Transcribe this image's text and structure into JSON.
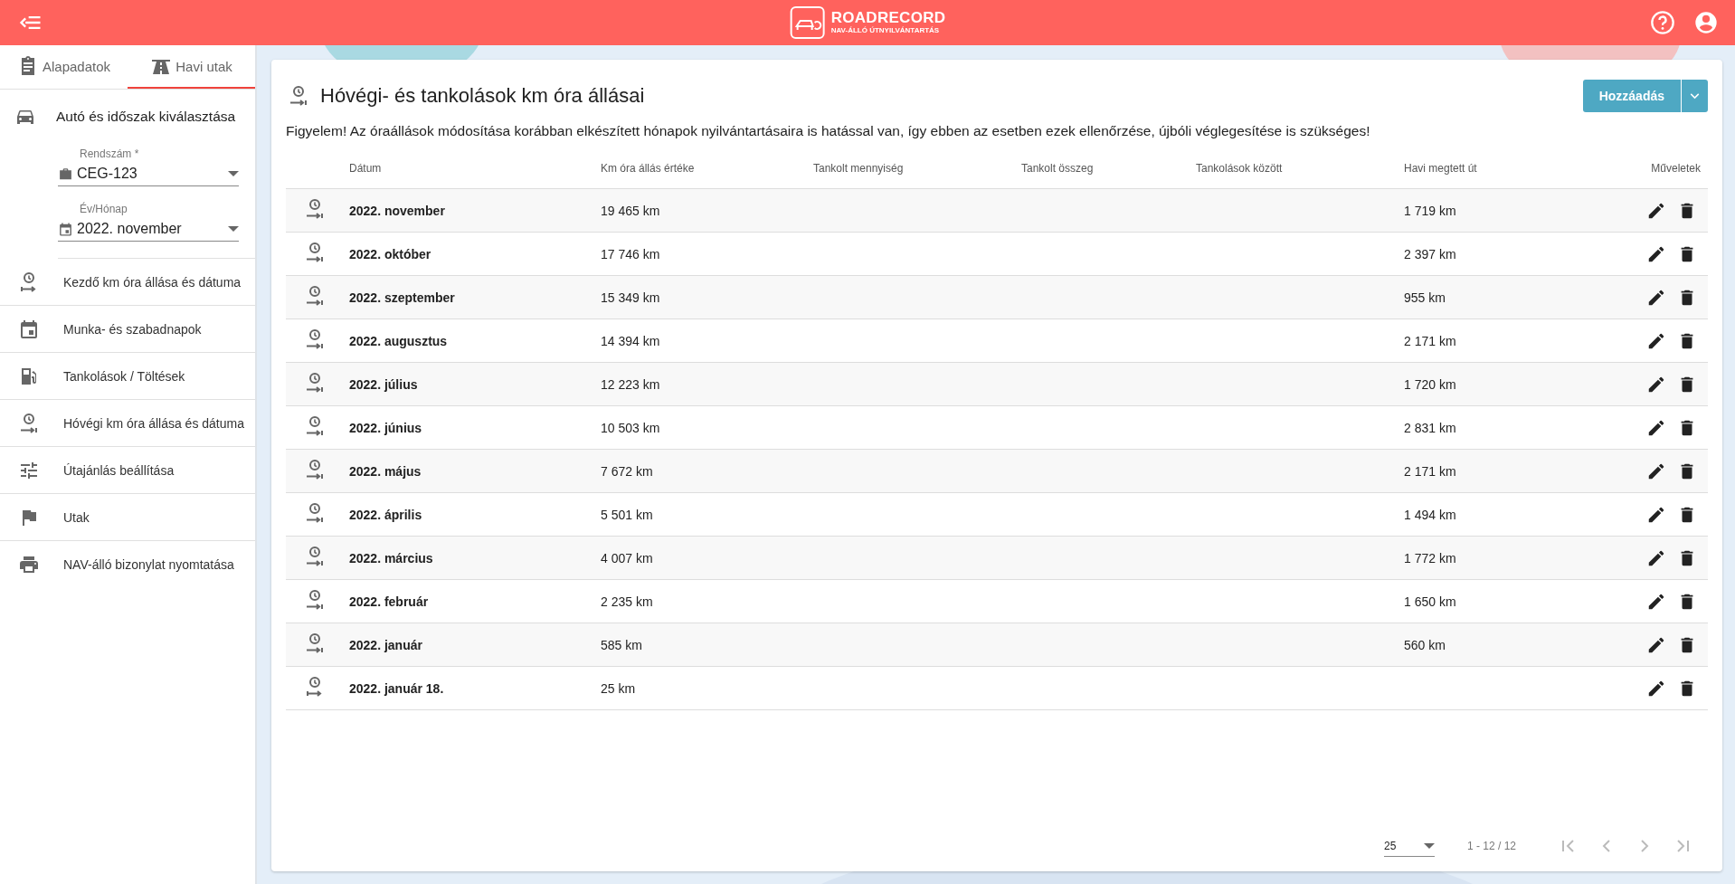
{
  "header": {
    "logo_title": "ROADRECORD",
    "logo_subtitle": "NAV-ÁLLÓ ÚTNYILVÁNTARTÁS"
  },
  "sidebar": {
    "tabs": [
      {
        "label": "Alapadatok",
        "selected": false
      },
      {
        "label": "Havi utak",
        "selected": true
      }
    ],
    "section_title": "Autó és időszak kiválasztása",
    "fields": [
      {
        "label": "Rendszám *",
        "value": "CEG-123"
      },
      {
        "label": "Év/Hónap",
        "value": "2022. november"
      }
    ],
    "items": [
      {
        "label": "Kezdő km óra állása és dátuma"
      },
      {
        "label": "Munka- és szabadnapok"
      },
      {
        "label": "Tankolások / Töltések"
      },
      {
        "label": "Hóvégi km óra állása és dátuma"
      },
      {
        "label": "Útajánlás beállítása"
      },
      {
        "label": "Utak"
      },
      {
        "label": "NAV-álló bizonylat nyomtatása"
      }
    ]
  },
  "page": {
    "title": "Hóvégi- és tankolások km óra állásai",
    "add_button": "Hozzáadás",
    "warning": "Figyelem! Az óraállások módosítása korábban elkészített hónapok nyilvántartásaira is hatással van, így ebben az esetben ezek ellenőrzése, újbóli véglegesítése is szükséges!"
  },
  "table": {
    "columns": [
      "Dátum",
      "Km óra állás értéke",
      "Tankolt mennyiség",
      "Tankolt összeg",
      "Tankolások között",
      "Havi megtett út",
      "Műveletek"
    ],
    "rows": [
      {
        "kind": "month_end",
        "date": "2022. november",
        "odometer": "19 465 km",
        "monthly": "1 719 km"
      },
      {
        "kind": "month_end",
        "date": "2022. október",
        "odometer": "17 746 km",
        "monthly": "2 397 km"
      },
      {
        "kind": "month_end",
        "date": "2022. szeptember",
        "odometer": "15 349 km",
        "monthly": "955 km"
      },
      {
        "kind": "month_end",
        "date": "2022. augusztus",
        "odometer": "14 394 km",
        "monthly": "2 171 km"
      },
      {
        "kind": "month_end",
        "date": "2022. július",
        "odometer": "12 223 km",
        "monthly": "1 720 km"
      },
      {
        "kind": "month_end",
        "date": "2022. június",
        "odometer": "10 503 km",
        "monthly": "2 831 km"
      },
      {
        "kind": "month_end",
        "date": "2022. május",
        "odometer": "7 672 km",
        "monthly": "2 171 km"
      },
      {
        "kind": "month_end",
        "date": "2022. április",
        "odometer": "5 501 km",
        "monthly": "1 494 km"
      },
      {
        "kind": "month_end",
        "date": "2022. március",
        "odometer": "4 007 km",
        "monthly": "1 772 km"
      },
      {
        "kind": "month_end",
        "date": "2022. február",
        "odometer": "2 235 km",
        "monthly": "1 650 km"
      },
      {
        "kind": "month_end",
        "date": "2022. január",
        "odometer": "585 km",
        "monthly": "560 km"
      },
      {
        "kind": "start",
        "date": "2022. január 18.",
        "odometer": "25 km",
        "monthly": ""
      }
    ]
  },
  "pagination": {
    "page_size": "25",
    "range": "1 - 12 / 12",
    "first_disabled": true,
    "prev_disabled": true,
    "next_disabled": true,
    "last_disabled": true
  }
}
